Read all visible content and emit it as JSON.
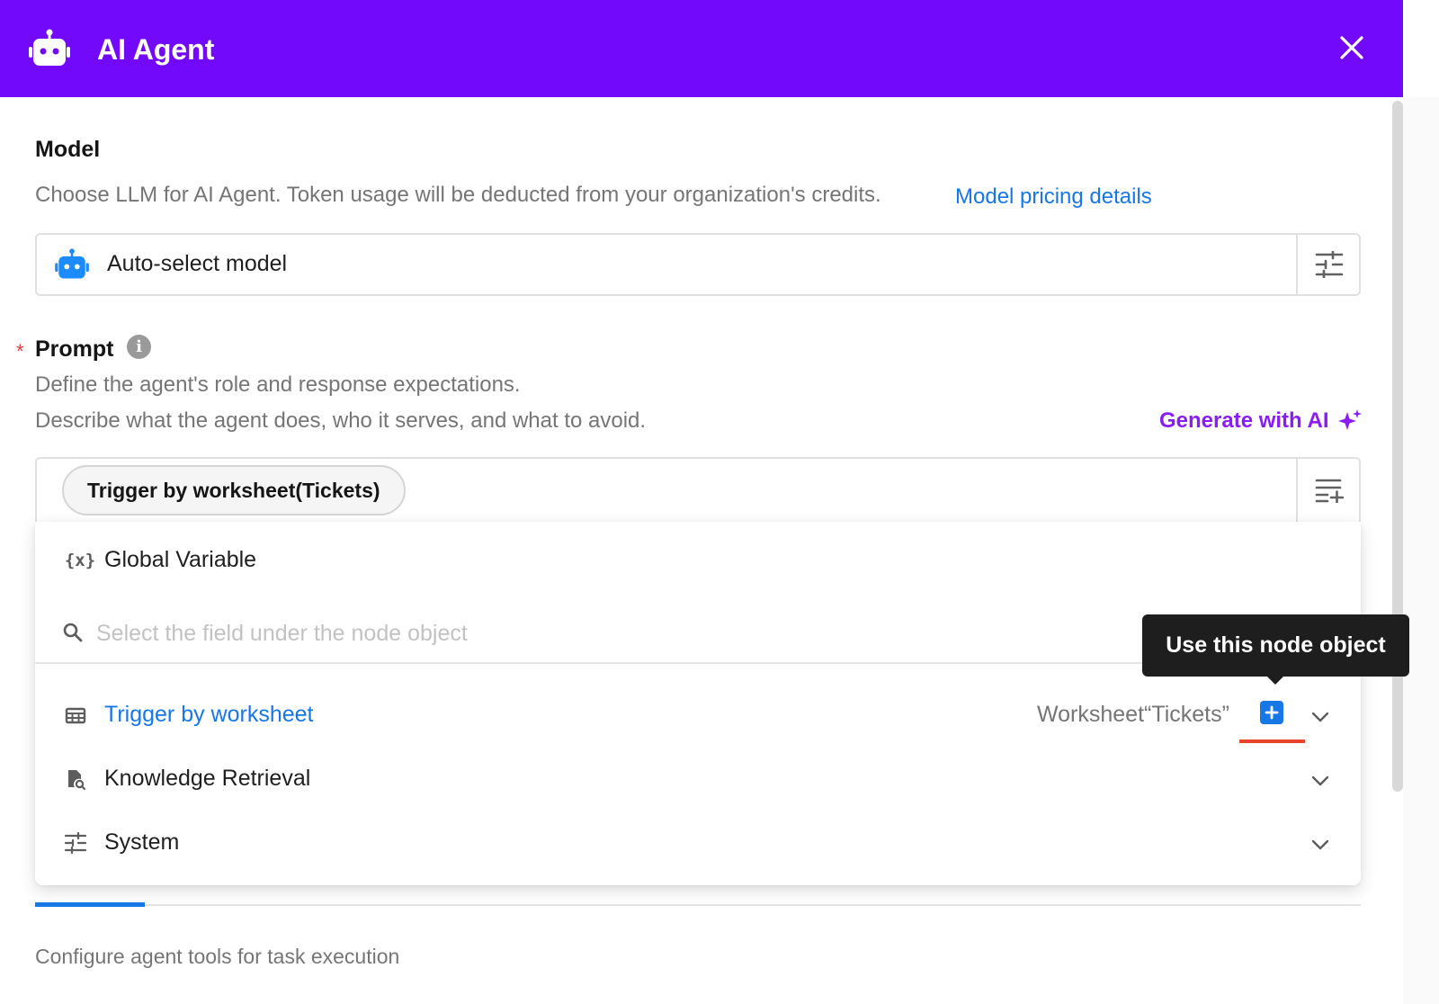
{
  "header": {
    "title": "AI Agent",
    "bg_color": "#7209fb",
    "icon": "robot-icon",
    "close_icon": "close-icon"
  },
  "model": {
    "title": "Model",
    "description": "Choose LLM for AI Agent. Token usage will be deducted from your organization's credits.",
    "pricing_link": "Model pricing details",
    "selected": "Auto-select model",
    "model_icon": "robot-icon",
    "settings_icon": "sliders-icon"
  },
  "prompt": {
    "required_mark": "*",
    "title": "Prompt",
    "info_icon": "info-icon",
    "description_line1": "Define the agent's role and response expectations.",
    "description_line2": "Describe what the agent does, who it serves, and what to avoid.",
    "generate_label": "Generate with AI",
    "generate_icon": "sparkle-icon",
    "chip": "Trigger by worksheet(Tickets)",
    "insert_icon": "insert-variable-icon"
  },
  "dropdown": {
    "global_variable": "Global Variable",
    "search_placeholder": "Select the field under the node object",
    "items": [
      {
        "label": "Trigger by worksheet",
        "icon": "table-icon",
        "tag": "Worksheet“Tickets”",
        "active": true
      },
      {
        "label": "Knowledge Retrieval",
        "icon": "document-search-icon"
      },
      {
        "label": "System",
        "icon": "sliders-icon"
      }
    ]
  },
  "tooltip": {
    "text": "Use this node object"
  },
  "tools": {
    "description": "Configure agent tools for task execution"
  },
  "colors": {
    "accent_blue": "#1677e6",
    "purple": "#8a1cf5",
    "annotation_red": "#e8452c"
  }
}
